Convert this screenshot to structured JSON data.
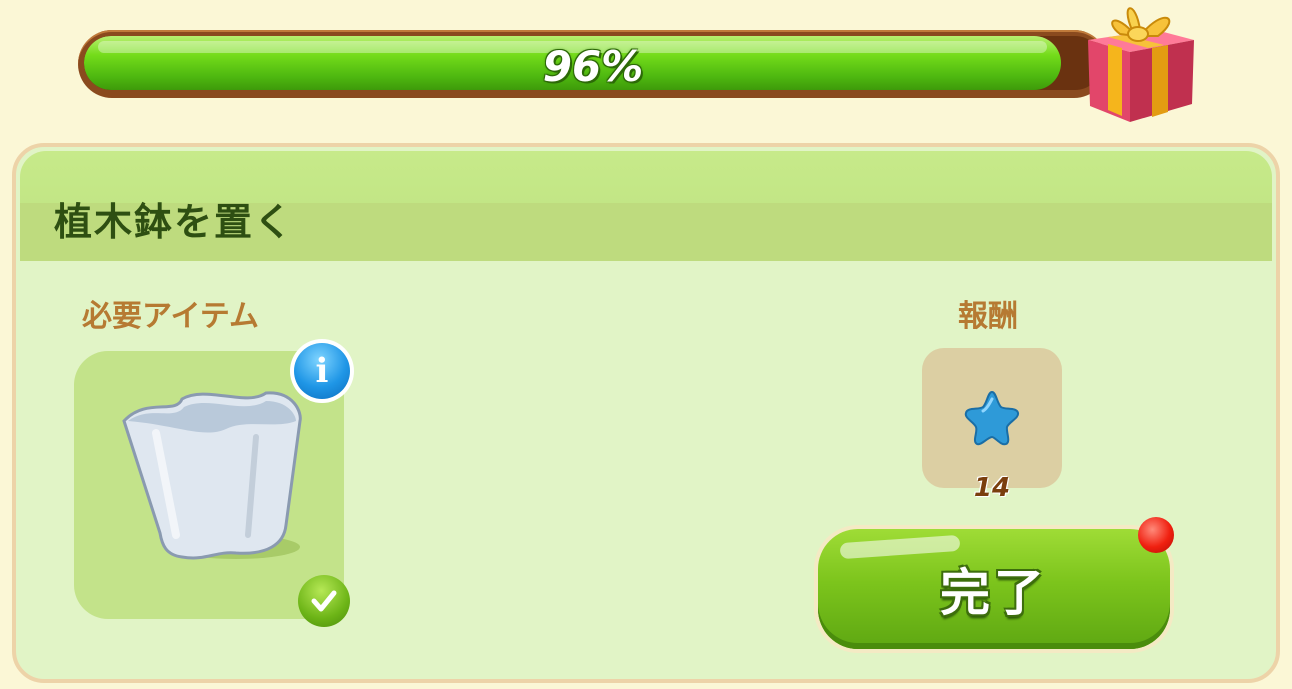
{
  "progress": {
    "value": 0.96,
    "label": "96%"
  },
  "quest": {
    "title": "植木鉢を置く",
    "required_label": "必要アイテム",
    "reward_label": "報酬",
    "required_item": {
      "icon": "flower-pot-icon",
      "status": "complete"
    },
    "reward": {
      "icon": "blue-star-icon",
      "count": "14"
    },
    "complete_button_label": "完了"
  },
  "colors": {
    "progress_fill": "#74dc1a",
    "panel": "#e1f4c6",
    "header": "#c1e584",
    "section_label": "#b67a32",
    "title_text": "#2e4f12",
    "button": "#7cc41c",
    "notification": "#f02010"
  }
}
